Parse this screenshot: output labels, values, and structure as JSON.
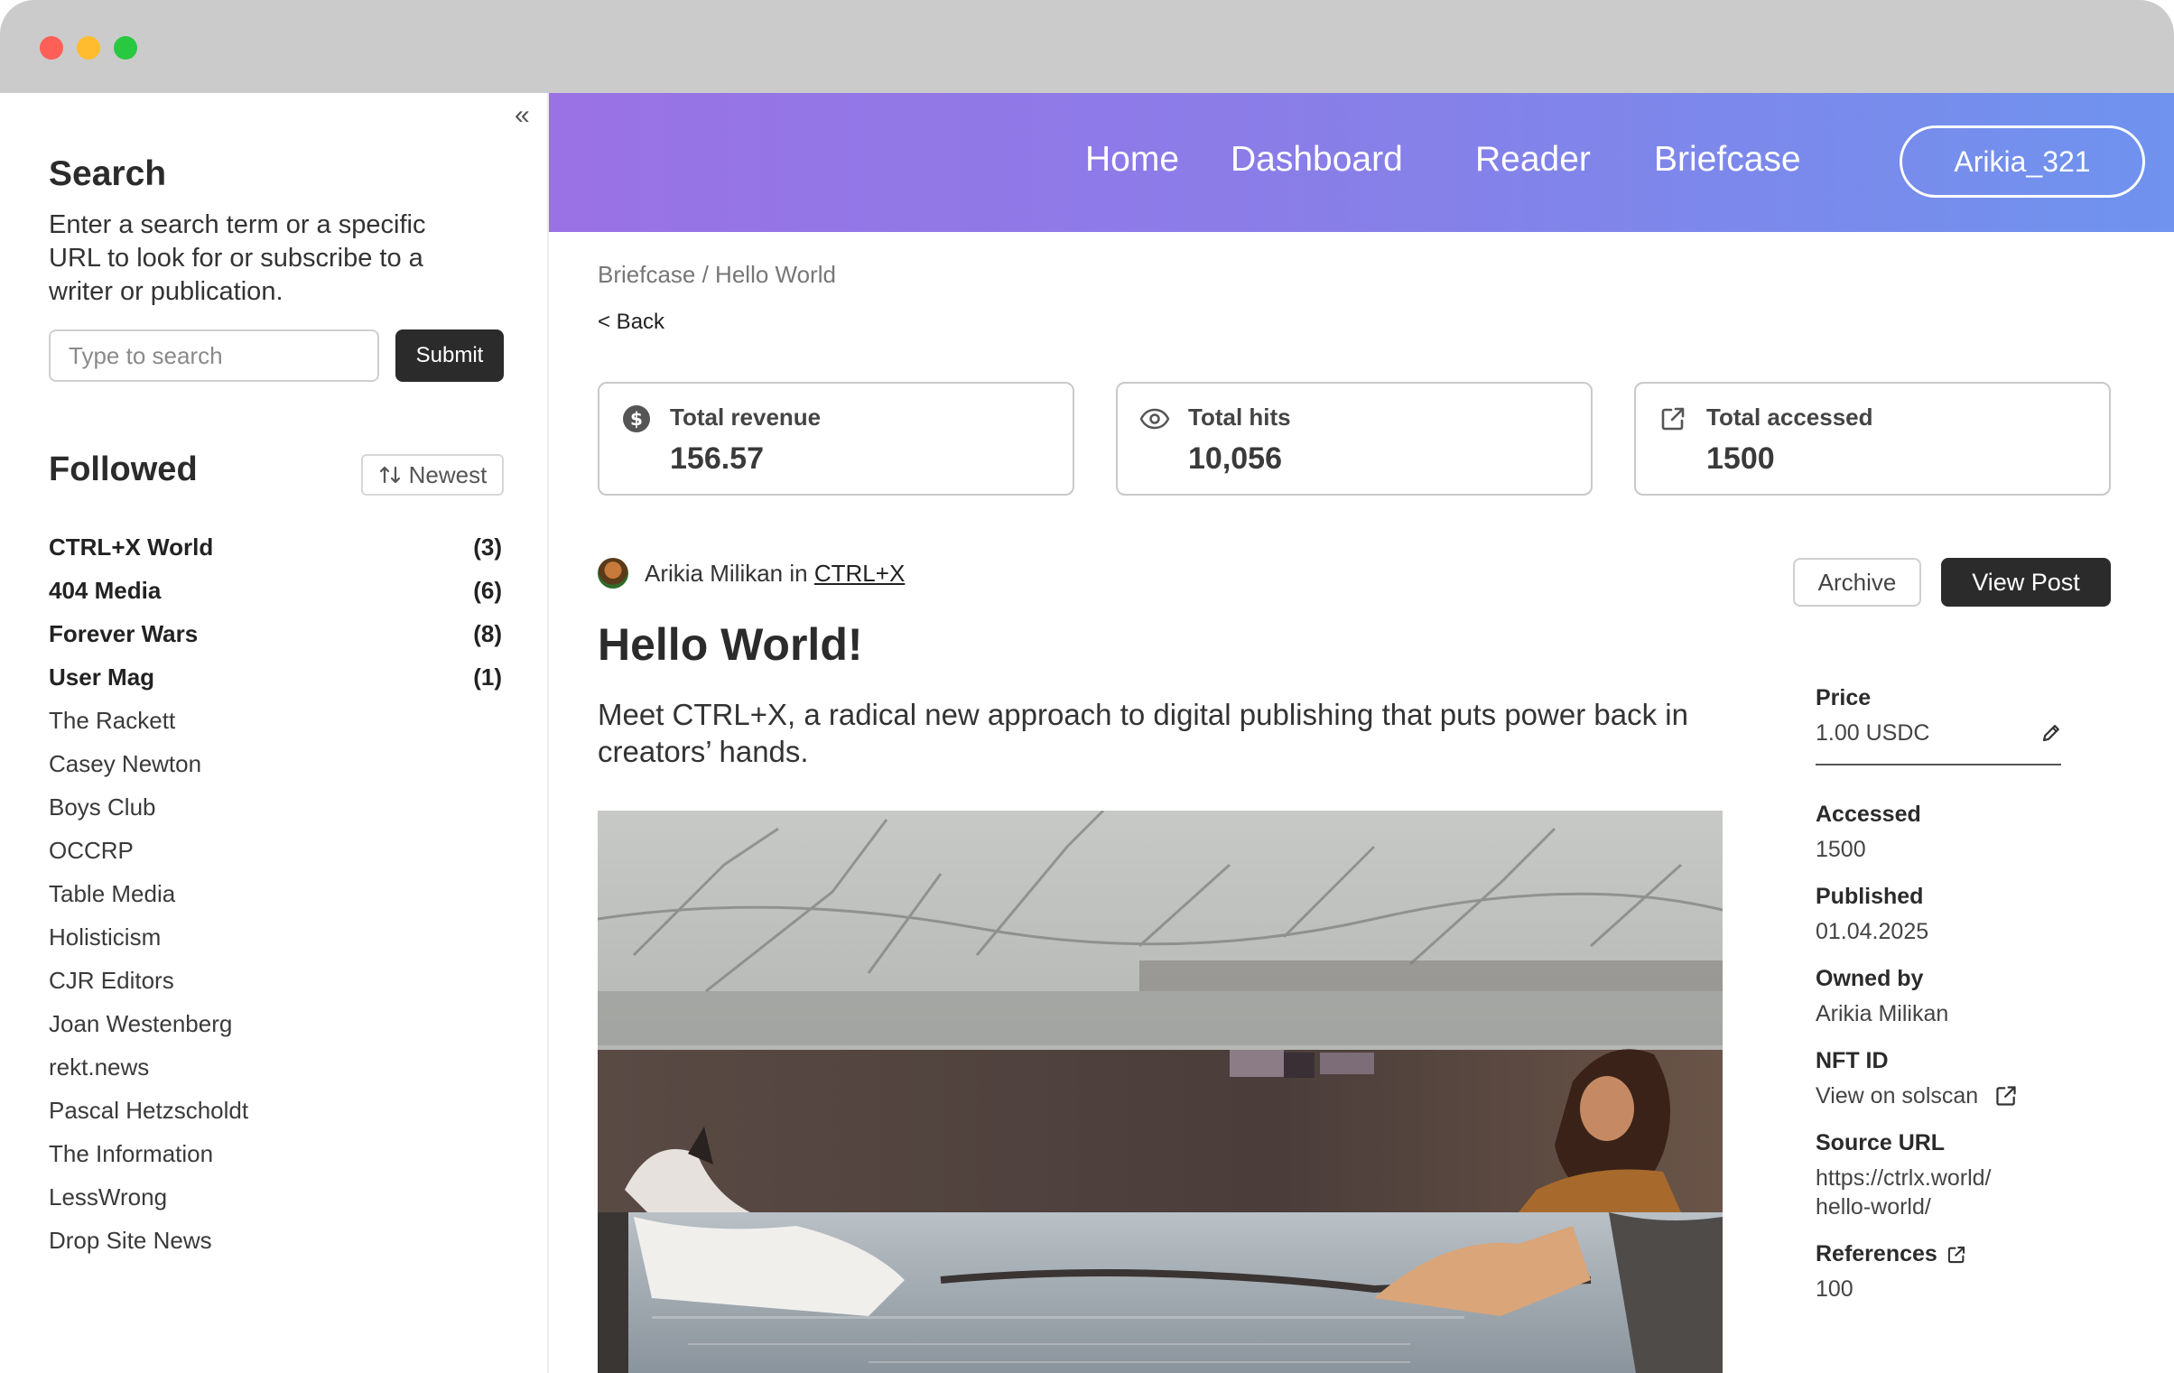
{
  "sidebar": {
    "search_title": "Search",
    "search_desc": "Enter a search term or a specific URL to look for or subscribe to a writer or publication.",
    "search_placeholder": "Type to search",
    "submit_label": "Submit",
    "followed_title": "Followed",
    "sort_label": "Newest",
    "followed": [
      {
        "name": "CTRL+X World",
        "count": "(3)",
        "bold": true
      },
      {
        "name": "404 Media",
        "count": "(6)",
        "bold": true
      },
      {
        "name": "Forever Wars",
        "count": "(8)",
        "bold": true
      },
      {
        "name": "User Mag",
        "count": "(1)",
        "bold": true
      },
      {
        "name": "The Rackett",
        "count": "",
        "bold": false
      },
      {
        "name": "Casey Newton",
        "count": "",
        "bold": false
      },
      {
        "name": "Boys Club",
        "count": "",
        "bold": false
      },
      {
        "name": "OCCRP",
        "count": "",
        "bold": false
      },
      {
        "name": "Table Media",
        "count": "",
        "bold": false
      },
      {
        "name": "Holisticism",
        "count": "",
        "bold": false
      },
      {
        "name": "CJR Editors",
        "count": "",
        "bold": false
      },
      {
        "name": "Joan Westenberg",
        "count": "",
        "bold": false
      },
      {
        "name": "rekt.news",
        "count": "",
        "bold": false
      },
      {
        "name": "Pascal Hetzscholdt",
        "count": "",
        "bold": false
      },
      {
        "name": "The Information",
        "count": "",
        "bold": false
      },
      {
        "name": "LessWrong",
        "count": "",
        "bold": false
      },
      {
        "name": "Drop Site News",
        "count": "",
        "bold": false
      }
    ]
  },
  "nav": {
    "home": "Home",
    "dashboard": "Dashboard",
    "reader": "Reader",
    "briefcase": "Briefcase",
    "user": "Arikia_321"
  },
  "page": {
    "breadcrumb": "Briefcase / Hello World",
    "back": "< Back",
    "stats": [
      {
        "label": "Total revenue",
        "value": "156.57",
        "icon": "dollar-icon"
      },
      {
        "label": "Total hits",
        "value": "10,056",
        "icon": "eye-icon"
      },
      {
        "label": "Total accessed",
        "value": "1500",
        "icon": "external-link-icon"
      }
    ],
    "author": "Arikia Milikan",
    "in_word": "in",
    "publication": "CTRL+X",
    "archive_label": "Archive",
    "view_post_label": "View Post",
    "title": "Hello World!",
    "description": "Meet CTRL+X, a radical new approach to digital publishing that puts power back in creators’ hands."
  },
  "meta": {
    "price_label": "Price",
    "price_value": "1.00 USDC",
    "accessed_label": "Accessed",
    "accessed_value": "1500",
    "published_label": "Published",
    "published_value": "01.04.2025",
    "owned_label": "Owned by",
    "owned_value": "Arikia Milikan",
    "nft_label": "NFT ID",
    "nft_value": "View on solscan",
    "source_label": "Source URL",
    "source_value": "https://ctrlx.world/ hello-world/",
    "references_label": "References",
    "references_value": "100"
  },
  "colors": {
    "nav_gradient_start": "#9a72e6",
    "nav_gradient_end": "#6f93ee",
    "dark_button": "#2b2b2b"
  }
}
